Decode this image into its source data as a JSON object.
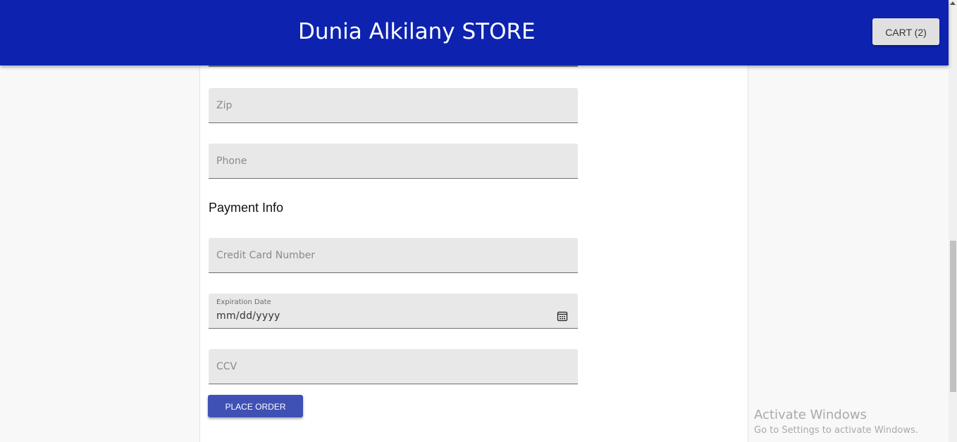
{
  "header": {
    "store_title": "Dunia Alkilany STORE",
    "cart_label": "CART (2)",
    "background_color": "#0d23b0"
  },
  "form": {
    "zip_placeholder": "Zip",
    "phone_placeholder": "Phone",
    "payment_heading": "Payment Info",
    "card_number_placeholder": "Credit Card Number",
    "expiration_label": "Expiration Date",
    "expiration_value": "mm/dd/yyyy",
    "calendar_icon": "calendar-icon",
    "ccv_placeholder": "CCV",
    "place_order_label": "PLACE ORDER",
    "place_order_color": "#3f51b5"
  },
  "watermark": {
    "title": "Activate Windows",
    "subtitle": "Go to Settings to activate Windows."
  }
}
